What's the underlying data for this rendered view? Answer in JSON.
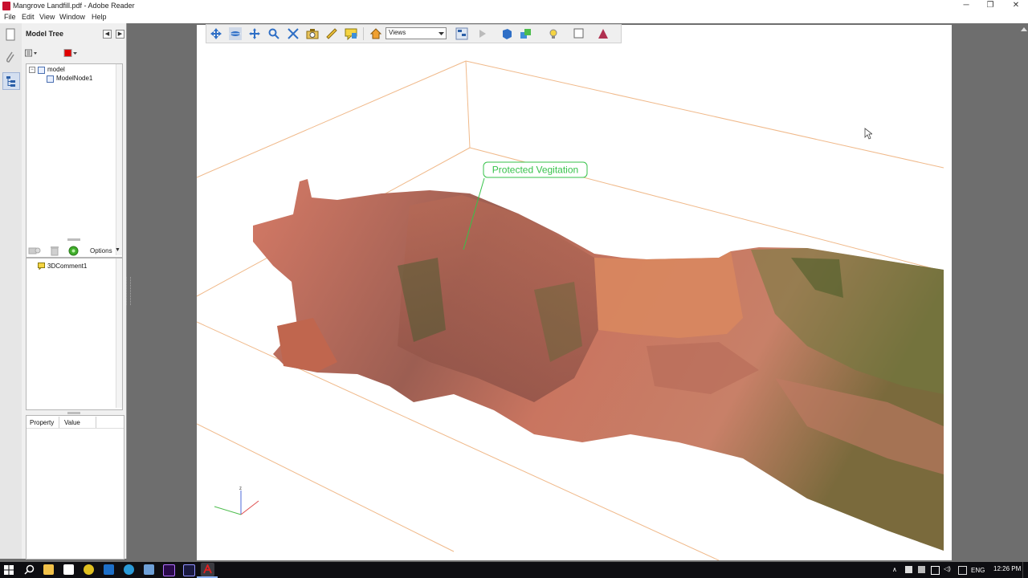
{
  "window": {
    "title": "Mangrove Landfill.pdf - Adobe Reader",
    "minimize_glyph": "─",
    "restore_glyph": "❐",
    "close_glyph": "✕"
  },
  "menu": [
    "File",
    "Edit",
    "View",
    "Window",
    "Help"
  ],
  "model_tree": {
    "title": "Model Tree",
    "nodes": [
      {
        "label": "model",
        "checked": true
      },
      {
        "label": "ModelNode1",
        "checked": true
      }
    ],
    "swatch_color": "#e00000"
  },
  "comments": {
    "options_label": "Options",
    "items": [
      "3DComment1"
    ]
  },
  "properties": {
    "columns": [
      "Property",
      "Value"
    ]
  },
  "toolbar3d": {
    "views_label": "Views"
  },
  "scene": {
    "annotation": "Protected Vegitation",
    "annotation_color": "#36c24a",
    "axis_label_z": "z"
  },
  "taskbar": {
    "language": "ENG",
    "time": "12:26 PM"
  }
}
